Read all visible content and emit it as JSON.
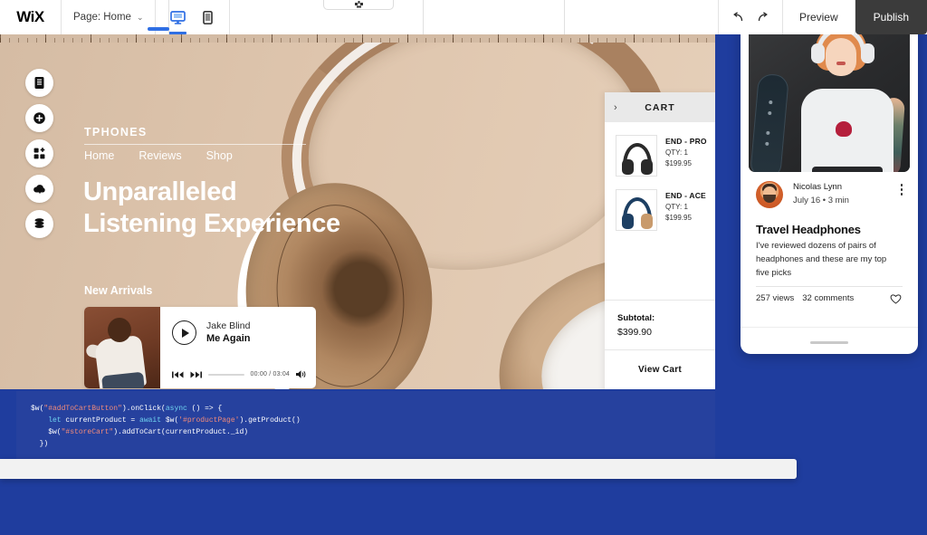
{
  "toolbar": {
    "logo": "WiX",
    "page_label": "Page: Home",
    "chevron": "⌄",
    "devices": [
      {
        "name": "desktop",
        "active": true
      },
      {
        "name": "mobile",
        "active": false
      }
    ],
    "undo_label": "undo",
    "redo_label": "redo",
    "preview_label": "Preview",
    "publish_label": "Publish"
  },
  "left_sidebar": {
    "items": [
      {
        "icon": "pages-icon",
        "label": "Pages"
      },
      {
        "icon": "add-icon",
        "label": "Add"
      },
      {
        "icon": "apps-icon",
        "label": "Apps"
      },
      {
        "icon": "upload-cloud-icon",
        "label": "Media"
      },
      {
        "icon": "database-icon",
        "label": "Database"
      }
    ]
  },
  "site": {
    "logo": "TPHONES",
    "nav": [
      "Home",
      "Reviews",
      "Shop"
    ],
    "headline_line1": "Unparalleled",
    "headline_line2": "Listening Experience",
    "section_label": "New Arrivals",
    "player": {
      "artist": "Jake Blind",
      "track": "Me Again",
      "time": "00:00 / 03:04",
      "play_icon": "play-icon",
      "prev_icon": "previous-track-icon",
      "next_icon": "next-track-icon",
      "volume_icon": "volume-icon"
    }
  },
  "cart": {
    "title": "CART",
    "collapse_chevron": "›",
    "items": [
      {
        "name": "END - PRO",
        "qty": "QTY: 1",
        "price": "$199.95",
        "color": "black"
      },
      {
        "name": "END - ACE",
        "qty": "QTY: 1",
        "price": "$199.95",
        "color": "blue"
      }
    ],
    "subtotal_label": "Subtotal:",
    "subtotal_value": "$399.90",
    "view_cart_label": "View Cart"
  },
  "code_panel": {
    "lines": [
      [
        {
          "t": "$w(",
          "c": "plain"
        },
        {
          "t": "\"#addToCartButton\"",
          "c": "string"
        },
        {
          "t": ").onClick(",
          "c": "plain"
        },
        {
          "t": "async",
          "c": "keyword"
        },
        {
          "t": " () => {",
          "c": "plain"
        }
      ],
      [
        {
          "t": "    ",
          "c": "plain"
        },
        {
          "t": "let",
          "c": "keyword"
        },
        {
          "t": " currentProduct = ",
          "c": "plain"
        },
        {
          "t": "await",
          "c": "keyword"
        },
        {
          "t": " $w(",
          "c": "plain"
        },
        {
          "t": "'#productPage'",
          "c": "string"
        },
        {
          "t": ").getProduct()",
          "c": "plain"
        }
      ],
      [
        {
          "t": "    $w(",
          "c": "plain"
        },
        {
          "t": "\"#storeCart\"",
          "c": "string"
        },
        {
          "t": ").addToCart(currentProduct._id)",
          "c": "plain"
        }
      ],
      [
        {
          "t": "  })",
          "c": "plain"
        }
      ]
    ]
  },
  "phone_preview": {
    "author": "Nicolas Lynn",
    "date": "July 16 •  3 min",
    "post_title": "Travel Headphones",
    "post_body": "I've reviewed dozens of pairs of headphones and these are my top five picks",
    "views": "257 views",
    "comments": "32 comments",
    "more_icon": "more-vertical-icon",
    "like_icon": "heart-icon"
  },
  "colors": {
    "editor_blue": "#26419e",
    "workspace_blue": "#1f3d9e",
    "hero_beige": "#dcc4ac",
    "publish_dark": "#3b3b3b",
    "active_device_blue": "#2f6fe4",
    "code_string": "#f08a7a",
    "code_keyword": "#6fd3ef"
  }
}
